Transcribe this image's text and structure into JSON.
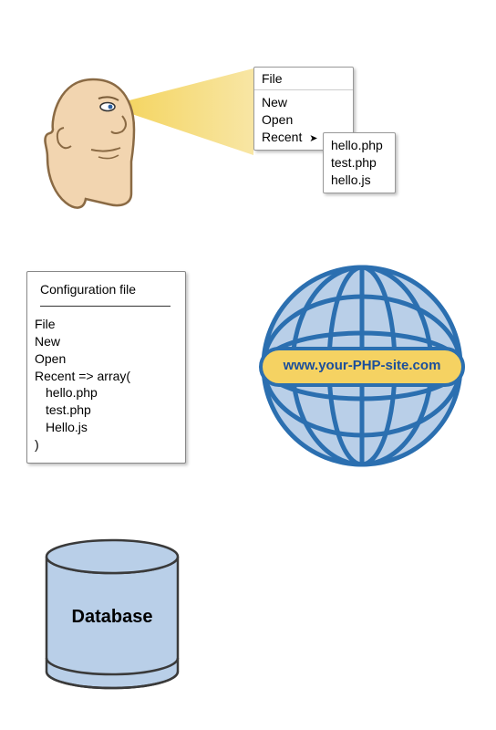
{
  "menu": {
    "title": "File",
    "items": [
      "New",
      "Open",
      "Recent"
    ],
    "recent_marker": "➤",
    "recent_files": [
      "hello.php",
      "test.php",
      "hello.js"
    ]
  },
  "config": {
    "title": "Configuration file",
    "lines": [
      "File",
      "New",
      "Open"
    ],
    "array_open": "Recent => array(",
    "array_items": [
      "hello.php",
      "test.php",
      "Hello.js"
    ],
    "array_close": ")"
  },
  "globe": {
    "url": "www.your-PHP-site.com"
  },
  "database": {
    "label": "Database"
  },
  "colors": {
    "skin": "#f2d5b0",
    "skin_stroke": "#8a6a44",
    "cone": "#f3d04e",
    "globe_fill": "#b9cfe8",
    "globe_stroke": "#2b6fb0",
    "banner_fill": "#f5d262",
    "banner_stroke": "#2b6fb0",
    "db_fill": "#b9cfe8",
    "db_stroke": "#3a3a3a"
  }
}
